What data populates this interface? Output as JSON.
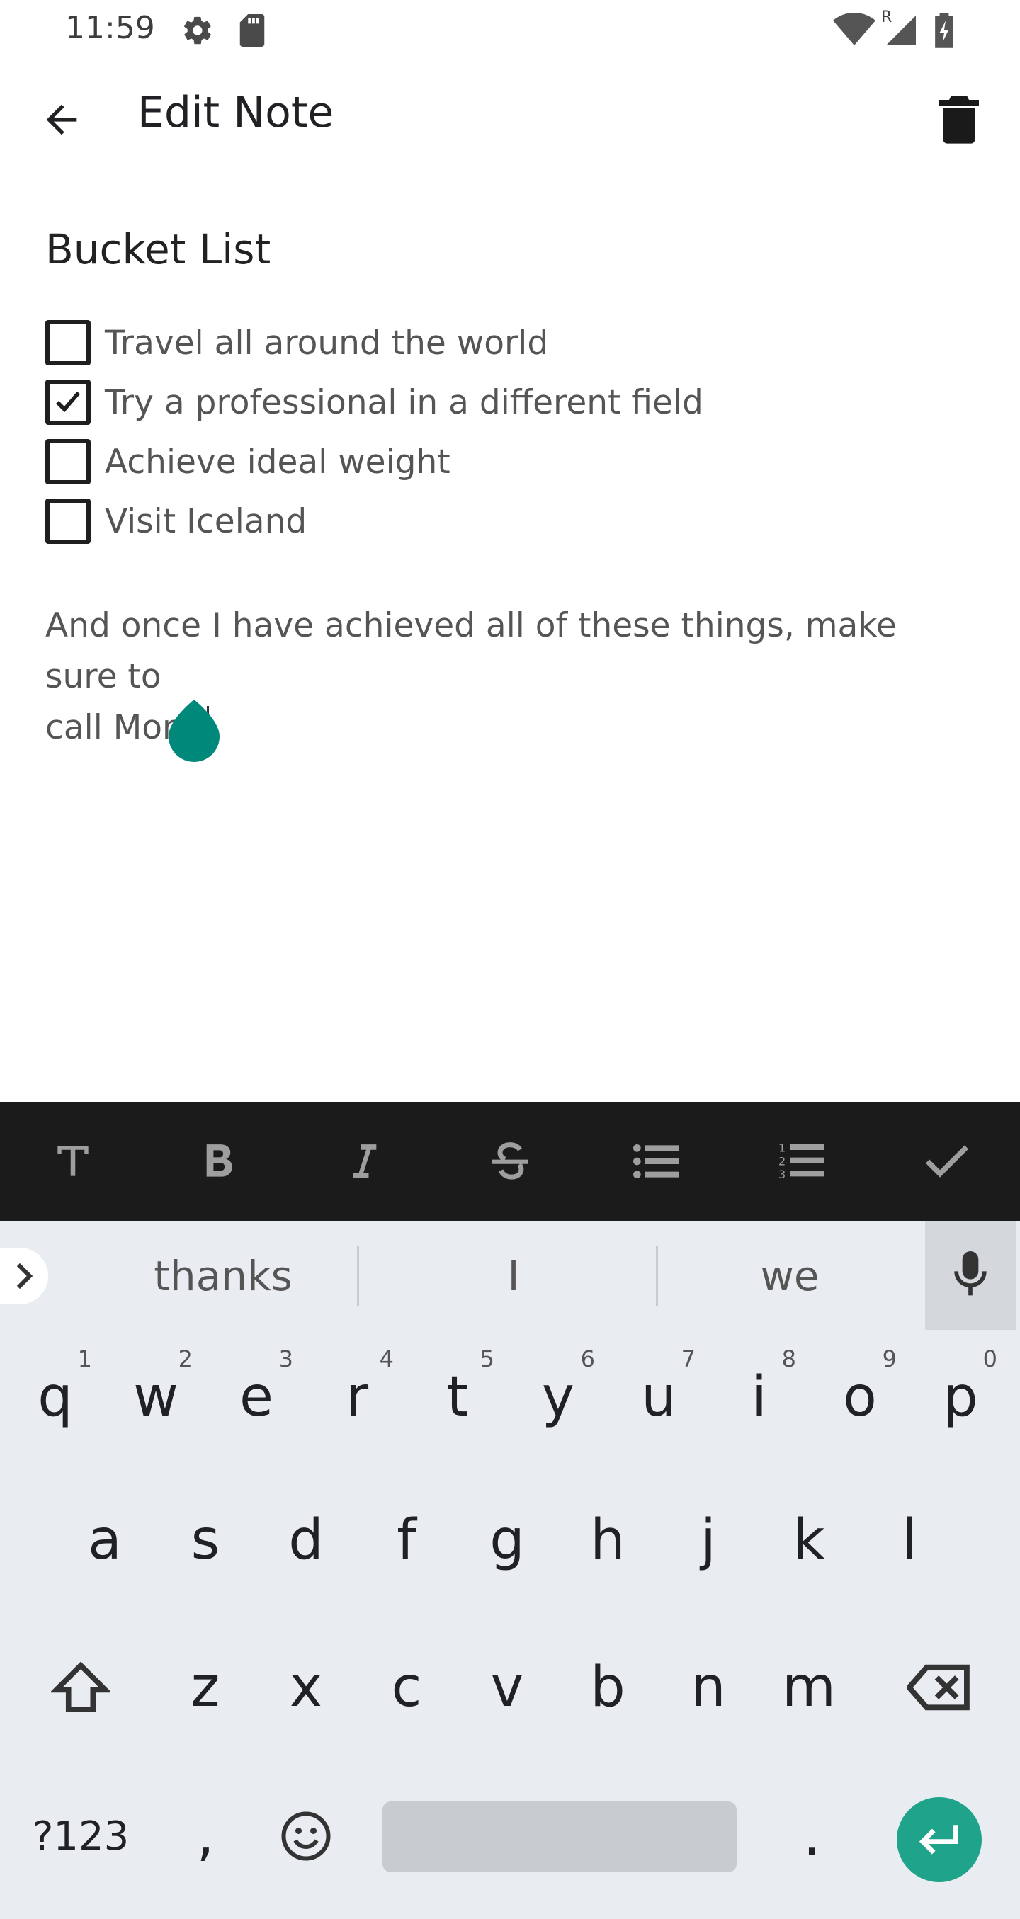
{
  "status_bar": {
    "time": "11:59",
    "roaming_label": "R"
  },
  "app_bar": {
    "title": "Edit Note"
  },
  "note": {
    "title": "Bucket List",
    "checklist": [
      {
        "label": "Travel all around the world",
        "checked": false
      },
      {
        "label": "Try a professional in a different field",
        "checked": true
      },
      {
        "label": "Achieve ideal weight",
        "checked": false
      },
      {
        "label": "Visit Iceland",
        "checked": false
      }
    ],
    "body_line1": "And once I have achieved all of these things, make sure to",
    "body_line2": "call Mom."
  },
  "format_toolbar": {
    "buttons": [
      "text-style",
      "bold",
      "italic",
      "strikethrough",
      "bulleted-list",
      "numbered-list",
      "done"
    ]
  },
  "keyboard": {
    "suggestions": [
      "thanks",
      "I",
      "we"
    ],
    "row1": [
      {
        "key": "q",
        "num": "1"
      },
      {
        "key": "w",
        "num": "2"
      },
      {
        "key": "e",
        "num": "3"
      },
      {
        "key": "r",
        "num": "4"
      },
      {
        "key": "t",
        "num": "5"
      },
      {
        "key": "y",
        "num": "6"
      },
      {
        "key": "u",
        "num": "7"
      },
      {
        "key": "i",
        "num": "8"
      },
      {
        "key": "o",
        "num": "9"
      },
      {
        "key": "p",
        "num": "0"
      }
    ],
    "row2": [
      "a",
      "s",
      "d",
      "f",
      "g",
      "h",
      "j",
      "k",
      "l"
    ],
    "row3": [
      "z",
      "x",
      "c",
      "v",
      "b",
      "n",
      "m"
    ],
    "symbols_label": "?123",
    "comma_label": ",",
    "period_label": ".",
    "accent_color": "#1fa38a"
  },
  "colors": {
    "toolbar_bg": "#1b1b1b",
    "keyboard_bg": "#e9edf2",
    "handle_color": "#00897b"
  }
}
